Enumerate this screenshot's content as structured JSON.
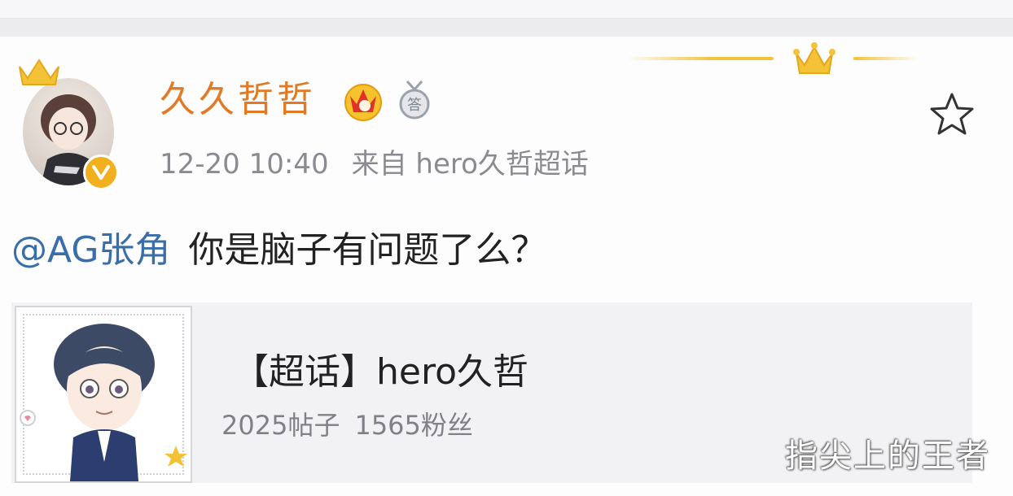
{
  "post": {
    "author": {
      "name": "久久哲哲",
      "avatar_icon": "avatar-illustration",
      "vip_badge_icon": "vip-crown-badge-icon",
      "rank_badge_icon": "rank-medal-icon",
      "verified_icon": "verified-icon"
    },
    "meta": {
      "timestamp": "12-20 10:40",
      "source": "来自 hero久哲超话"
    },
    "mention": "@AG张角",
    "text": "你是脑子有问题了么？",
    "favorite_icon": "star-icon"
  },
  "topic_card": {
    "title": "【超话】hero久哲",
    "posts": "2025帖子",
    "followers": "1565粉丝"
  },
  "watermark": "指尖上的王者",
  "colors": {
    "username": "#e07a24",
    "mention": "#3a6ea8",
    "accent_gold": "#f2c23a"
  }
}
